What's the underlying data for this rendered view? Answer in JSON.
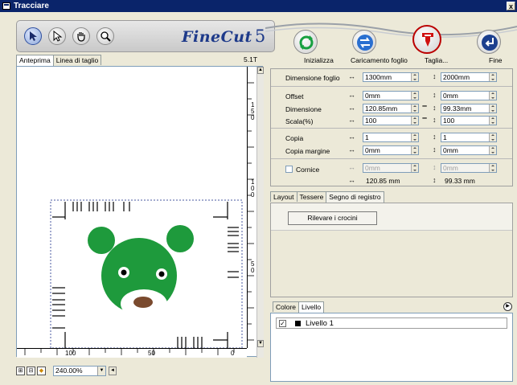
{
  "window": {
    "title": "Tracciare",
    "close_glyph": "x"
  },
  "toolbar": {
    "tools": [
      "selection-arrow-icon",
      "node-arrow-icon",
      "hand-icon",
      "zoom-icon"
    ],
    "logo": "FineCut",
    "logo_version": "5",
    "actions": [
      {
        "label": "Inizializza",
        "icon": "refresh-icon"
      },
      {
        "label": "Caricamento foglio",
        "icon": "swap-arrows-icon"
      },
      {
        "label": "Taglia...",
        "icon": "cutter-icon"
      },
      {
        "label": "Fine",
        "icon": "return-icon"
      }
    ]
  },
  "preview": {
    "tabs": [
      "Anteprima",
      "Linea di taglio"
    ],
    "version": "5.1T",
    "ruler_v_labels": [
      "150",
      "100",
      "50"
    ],
    "ruler_h_labels": [
      "100",
      "50",
      "0"
    ],
    "zoom": "240.00%"
  },
  "settings": {
    "dimensione_foglio": {
      "label": "Dimensione foglio",
      "w": "1300mm",
      "h": "2000mm"
    },
    "offset": {
      "label": "Offset",
      "w": "0mm",
      "h": "0mm"
    },
    "dimensione": {
      "label": "Dimensione",
      "w": "120.85mm",
      "h": "99.33mm"
    },
    "scala": {
      "label": "Scala(%)",
      "w": "100",
      "h": "100"
    },
    "copia": {
      "label": "Copia",
      "w": "1",
      "h": "1"
    },
    "copia_margine": {
      "label": "Copia margine",
      "w": "0mm",
      "h": "0mm"
    },
    "cornice": {
      "label": "Cornice",
      "w": "0mm",
      "h": "0mm"
    },
    "result": {
      "w": "120.85 mm",
      "h": "99.33 mm"
    }
  },
  "tabs": {
    "items": [
      "Layout",
      "Tessere",
      "Segno di registro"
    ],
    "active": "Segno di registro",
    "button": "Rilevare i crocini"
  },
  "layers": {
    "tabs": [
      "Colore",
      "Livello"
    ],
    "rows": [
      {
        "name": "Livello 1",
        "visible": true
      }
    ]
  },
  "colors": {
    "bear_green": "#1e9a3c",
    "bear_nose": "#7a4a2e",
    "accent_red": "#d01010",
    "title_blue": "#0a246a"
  }
}
